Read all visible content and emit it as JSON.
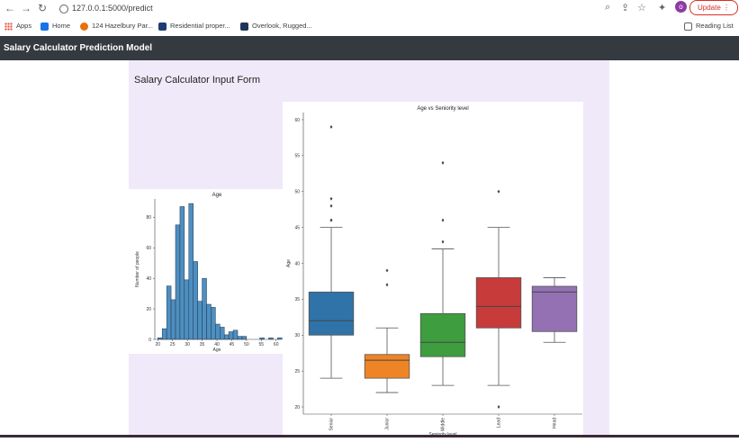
{
  "browser": {
    "url": "127.0.0.1:5000/predict",
    "update_label": "Update",
    "avatar_letter": "o",
    "reading_list": "Reading List",
    "bookmarks": [
      {
        "label": "Apps",
        "color": "#4285f4"
      },
      {
        "label": "Home",
        "color": "#1a73e8"
      },
      {
        "label": "124 Hazelbury Par...",
        "color": "#e8710a"
      },
      {
        "label": "Residential proper...",
        "color": "#1f3c73"
      },
      {
        "label": "Overlook, Rugged...",
        "color": "#1d3557"
      }
    ]
  },
  "navbar": {
    "brand": "Salary Calculator Prediction Model"
  },
  "main": {
    "form_title": "Salary Calculator Input Form"
  },
  "chart_data": [
    {
      "type": "bar",
      "title": "Age",
      "xlabel": "Age",
      "ylabel": "Number of people",
      "xlim": [
        19,
        61
      ],
      "ylim": [
        0,
        92
      ],
      "xticks": [
        20,
        25,
        30,
        35,
        40,
        45,
        50,
        55,
        60
      ],
      "yticks": [
        0,
        20,
        40,
        60,
        80
      ],
      "bin_edges": [
        20,
        21.5,
        23,
        24.5,
        26,
        27.5,
        29,
        30.5,
        32,
        33.5,
        35,
        36.5,
        38,
        39.5,
        41,
        42.5,
        44,
        45.5,
        47,
        48.5,
        50,
        51.5,
        53,
        54.5,
        56,
        57.5,
        59,
        60.5
      ],
      "values": [
        1,
        7,
        35,
        26,
        75,
        87,
        39,
        89,
        51,
        25,
        40,
        23,
        21,
        10,
        8,
        3,
        5,
        6,
        2,
        2,
        0,
        0,
        0,
        1,
        0,
        1,
        0,
        1
      ],
      "color": "#4e8fc0"
    },
    {
      "type": "box",
      "title": "Age vs Seniority level",
      "xlabel": "Seniority level",
      "ylabel": "Age",
      "ylim": [
        19,
        61
      ],
      "yticks": [
        20,
        25,
        30,
        35,
        40,
        45,
        50,
        55,
        60
      ],
      "categories": [
        "Senior",
        "Junior",
        "Middle",
        "Lead",
        "Head"
      ],
      "boxes": [
        {
          "name": "Senior",
          "whislo": 24,
          "q1": 30,
          "med": 32,
          "q3": 36,
          "whishi": 45,
          "fliers": [
            46,
            46,
            48,
            49,
            59
          ],
          "color": "#2f73a8"
        },
        {
          "name": "Junior",
          "whislo": 22,
          "q1": 24,
          "med": 26.5,
          "q3": 27.3,
          "whishi": 31,
          "fliers": [
            37,
            39
          ],
          "color": "#ef8427"
        },
        {
          "name": "Middle",
          "whislo": 23,
          "q1": 27,
          "med": 29,
          "q3": 33,
          "whishi": 42,
          "fliers": [
            43,
            46,
            54
          ],
          "color": "#3e9d3e"
        },
        {
          "name": "Lead",
          "whislo": 23,
          "q1": 31,
          "med": 34,
          "q3": 38,
          "whishi": 45,
          "fliers": [
            20,
            50
          ],
          "color": "#c73b3b"
        },
        {
          "name": "Head",
          "whislo": 29,
          "q1": 30.5,
          "med": 36,
          "q3": 36.8,
          "whishi": 38,
          "fliers": [],
          "color": "#9371b3"
        }
      ]
    }
  ]
}
